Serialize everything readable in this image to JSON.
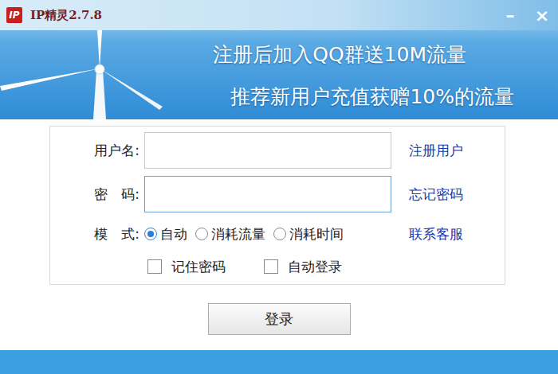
{
  "window": {
    "title": "IP精灵2.7.8",
    "logo": "IP",
    "controls": [
      "–",
      "×"
    ]
  },
  "banner": {
    "lines": [
      "注册后加入QQ群送10M流量",
      "推荐新用户充值获赠10%的流量"
    ]
  },
  "form": {
    "fields": [
      {
        "label": "用户名:",
        "value": "",
        "link": "注册用户",
        "focused": false,
        "kind": "text"
      },
      {
        "label": "密　码:",
        "value": "",
        "link": "忘记密码",
        "focused": true,
        "kind": "password"
      }
    ],
    "mode": {
      "label": "模　式:",
      "link": "联系客服",
      "options": [
        {
          "label": "自动",
          "selected": true
        },
        {
          "label": "消耗流量",
          "selected": false
        },
        {
          "label": "消耗时间",
          "selected": false
        }
      ]
    },
    "checkboxes": [
      {
        "label": "记住密码",
        "checked": false
      },
      {
        "label": "自动登录",
        "checked": false
      }
    ]
  },
  "buttons": [
    "登录"
  ]
}
